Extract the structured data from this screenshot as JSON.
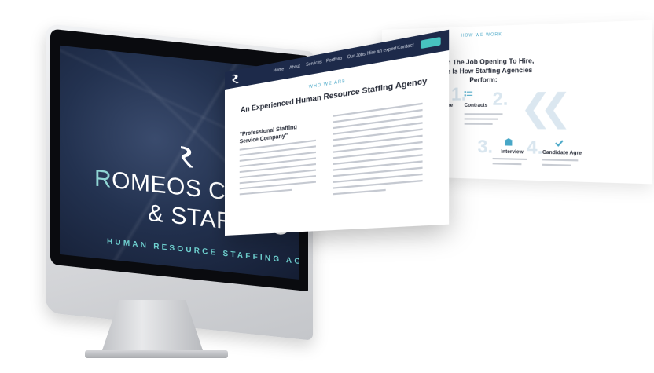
{
  "monitor": {
    "title_rest": "OMEOS CONSULTI",
    "title_initial": "R",
    "title_line2": "& STAFFING",
    "tagline": "HUMAN RESOURCE STAFFING AGENCY",
    "accent_color": "#6ed0cf"
  },
  "page1": {
    "nav": [
      "Home",
      "About",
      "Services",
      "Portfolio",
      "Our Jobs",
      "Hire an expert",
      "Contact"
    ],
    "cta": "",
    "kicker": "WHO WE ARE",
    "heading": "An Experienced Human Resource Staffing Agency",
    "quote": "\"Professional Staffing Service Company\"",
    "accent_color": "#47c3c0",
    "nav_color": "#1d2a4a"
  },
  "page2": {
    "kicker": "HOW WE WORK",
    "heading": "From The Job Opening To Hire, Here Is How Staffing Agencies Perform:",
    "steps": [
      {
        "num": "1.",
        "label": "nt with the"
      },
      {
        "num": "",
        "label": "Contracts"
      },
      {
        "num": "2.",
        "label": ""
      },
      {
        "num": "3.",
        "label": ""
      },
      {
        "num": "",
        "label": "Interview"
      },
      {
        "num": "4.",
        "label": "Candidate Agre"
      }
    ]
  }
}
